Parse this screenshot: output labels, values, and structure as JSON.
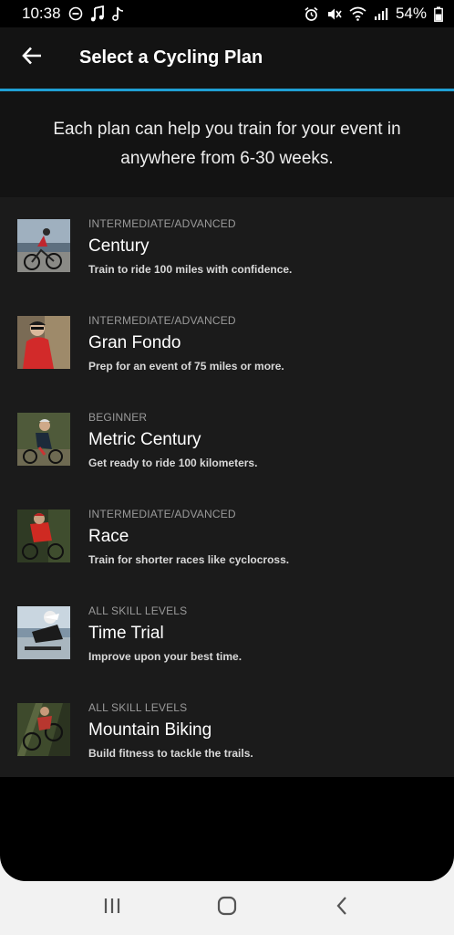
{
  "status_bar": {
    "time": "10:38",
    "battery": "54%",
    "left_icons": [
      "do-not-disturb-icon",
      "music-note-icon",
      "tiktok-icon"
    ],
    "right_icons": [
      "alarm-icon",
      "mute-icon",
      "wifi-icon",
      "signal-icon",
      "battery-icon"
    ]
  },
  "app_bar": {
    "title": "Select a Cycling Plan",
    "back_icon": "back-arrow-icon",
    "accent_color": "#1fa0d4"
  },
  "intro": {
    "text": "Each plan can help you train for your event in anywhere from 6-30 weeks."
  },
  "plans": [
    {
      "level": "INTERMEDIATE/ADVANCED",
      "name": "Century",
      "description": "Train to ride 100 miles with confidence."
    },
    {
      "level": "INTERMEDIATE/ADVANCED",
      "name": "Gran Fondo",
      "description": "Prep for an event of 75 miles or more."
    },
    {
      "level": "BEGINNER",
      "name": "Metric Century",
      "description": "Get ready to ride 100 kilometers."
    },
    {
      "level": "INTERMEDIATE/ADVANCED",
      "name": "Race",
      "description": "Train for shorter races like cyclocross."
    },
    {
      "level": "ALL SKILL LEVELS",
      "name": "Time Trial",
      "description": "Improve upon your best time."
    },
    {
      "level": "ALL SKILL LEVELS",
      "name": "Mountain Biking",
      "description": "Build fitness to tackle the trails."
    }
  ],
  "nav_bar": {
    "icons": [
      "recent-apps-icon",
      "home-icon",
      "back-icon"
    ]
  }
}
